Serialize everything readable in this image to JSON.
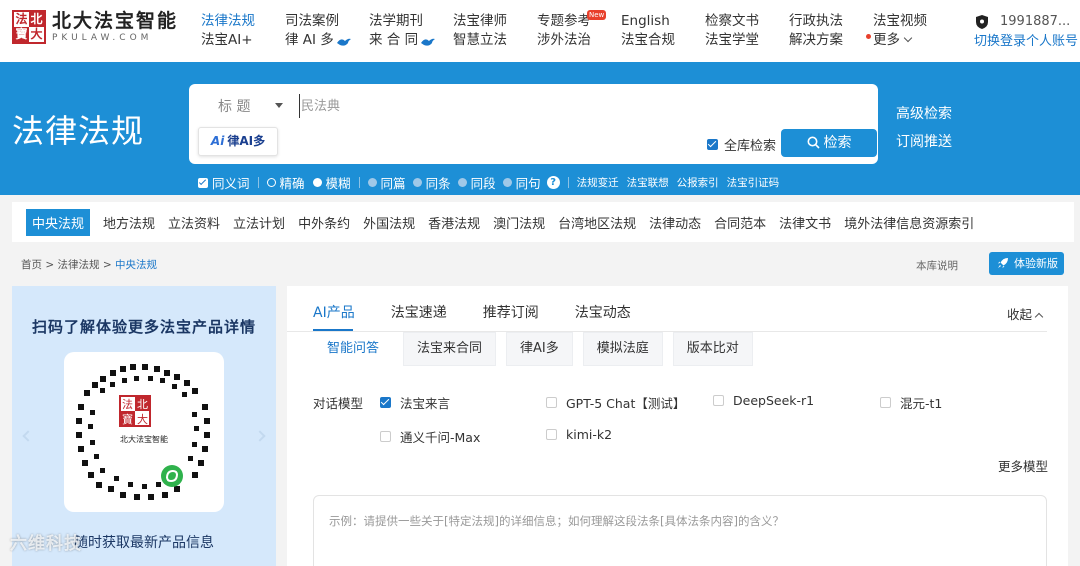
{
  "logo": {
    "seal_chars": [
      "法",
      "北",
      "寶",
      "大"
    ],
    "title": "北大法宝智能",
    "subtitle": "PKULAW.COM"
  },
  "nav": {
    "columns": [
      {
        "top": "法律法规",
        "bottom": "法宝AI+"
      },
      {
        "top": "司法案例",
        "bottom": "律 AI 多"
      },
      {
        "top": "法学期刊",
        "bottom": "来 合 同"
      },
      {
        "top": "法宝律师",
        "bottom": "智慧立法"
      },
      {
        "top": "专题参考",
        "bottom": "涉外法治",
        "badge": "New"
      },
      {
        "top": "English",
        "bottom": "法宝合规"
      },
      {
        "top": "检察文书",
        "bottom": "法宝学堂"
      },
      {
        "top": "行政执法",
        "bottom": "解决方案"
      },
      {
        "top": "法宝视频",
        "bottom": "更多"
      }
    ],
    "user_phone": "1991887...",
    "switch_account": "切换登录个人账号"
  },
  "search": {
    "section_title": "法律法规",
    "field_select": "标 题",
    "placeholder": "民法典",
    "ai_button": "律AI多",
    "ai_prefix": "Ai",
    "fulltext_label": "全库检索",
    "search_button": "检索",
    "advanced": "高级检索",
    "subscribe": "订阅推送",
    "options": {
      "synonym": "同义词",
      "exact": "精确",
      "fuzzy": "模糊",
      "same_article": "同篇",
      "same_clause": "同条",
      "same_paragraph": "同段",
      "same_sentence": "同句",
      "links": [
        "法规变迁",
        "法宝联想",
        "公报索引",
        "法宝引证码"
      ]
    }
  },
  "categories": [
    "中央法规",
    "地方法规",
    "立法资料",
    "立法计划",
    "中外条约",
    "外国法规",
    "香港法规",
    "澳门法规",
    "台湾地区法规",
    "法律动态",
    "合同范本",
    "法律文书",
    "境外法律信息资源索引"
  ],
  "breadcrumb": {
    "home": "首页",
    "level1": "法律法规",
    "current": "中央法规",
    "sep": ">"
  },
  "library_desc": "本库说明",
  "trial_button": "体验新版",
  "promo": {
    "title": "扫码了解体验更多法宝产品详情",
    "bottom": "随时获取最新产品信息",
    "qr_seal_chars": [
      "法",
      "北",
      "寶",
      "大"
    ],
    "qr_caption": "北大法宝智能"
  },
  "watermark": "六维科技",
  "ai_panel": {
    "tabs": [
      "AI产品",
      "法宝速递",
      "推荐订阅",
      "法宝动态"
    ],
    "collapse": "收起",
    "subtabs": [
      "智能问答",
      "法宝来合同",
      "律AI多",
      "模拟法庭",
      "版本比对"
    ],
    "model_label": "对话模型",
    "models": [
      {
        "name": "法宝来言",
        "checked": true
      },
      {
        "name": "GPT-5 Chat【测试】",
        "checked": false
      },
      {
        "name": "DeepSeek-r1",
        "checked": false
      },
      {
        "name": "混元-t1",
        "checked": false
      },
      {
        "name": "通义千问-Max",
        "checked": false
      },
      {
        "name": "kimi-k2",
        "checked": false
      }
    ],
    "more_models": "更多模型",
    "prompt_placeholder": "示例：请提供一些关于[特定法规]的详细信息；如何理解这段法条[具体法条内容]的含义？"
  },
  "colors": {
    "primary": "#1d8fd6",
    "link": "#1a77c9",
    "logo_red": "#c0272d",
    "badge_red": "#e8402c",
    "promo_bg": "#d5e8fb"
  }
}
